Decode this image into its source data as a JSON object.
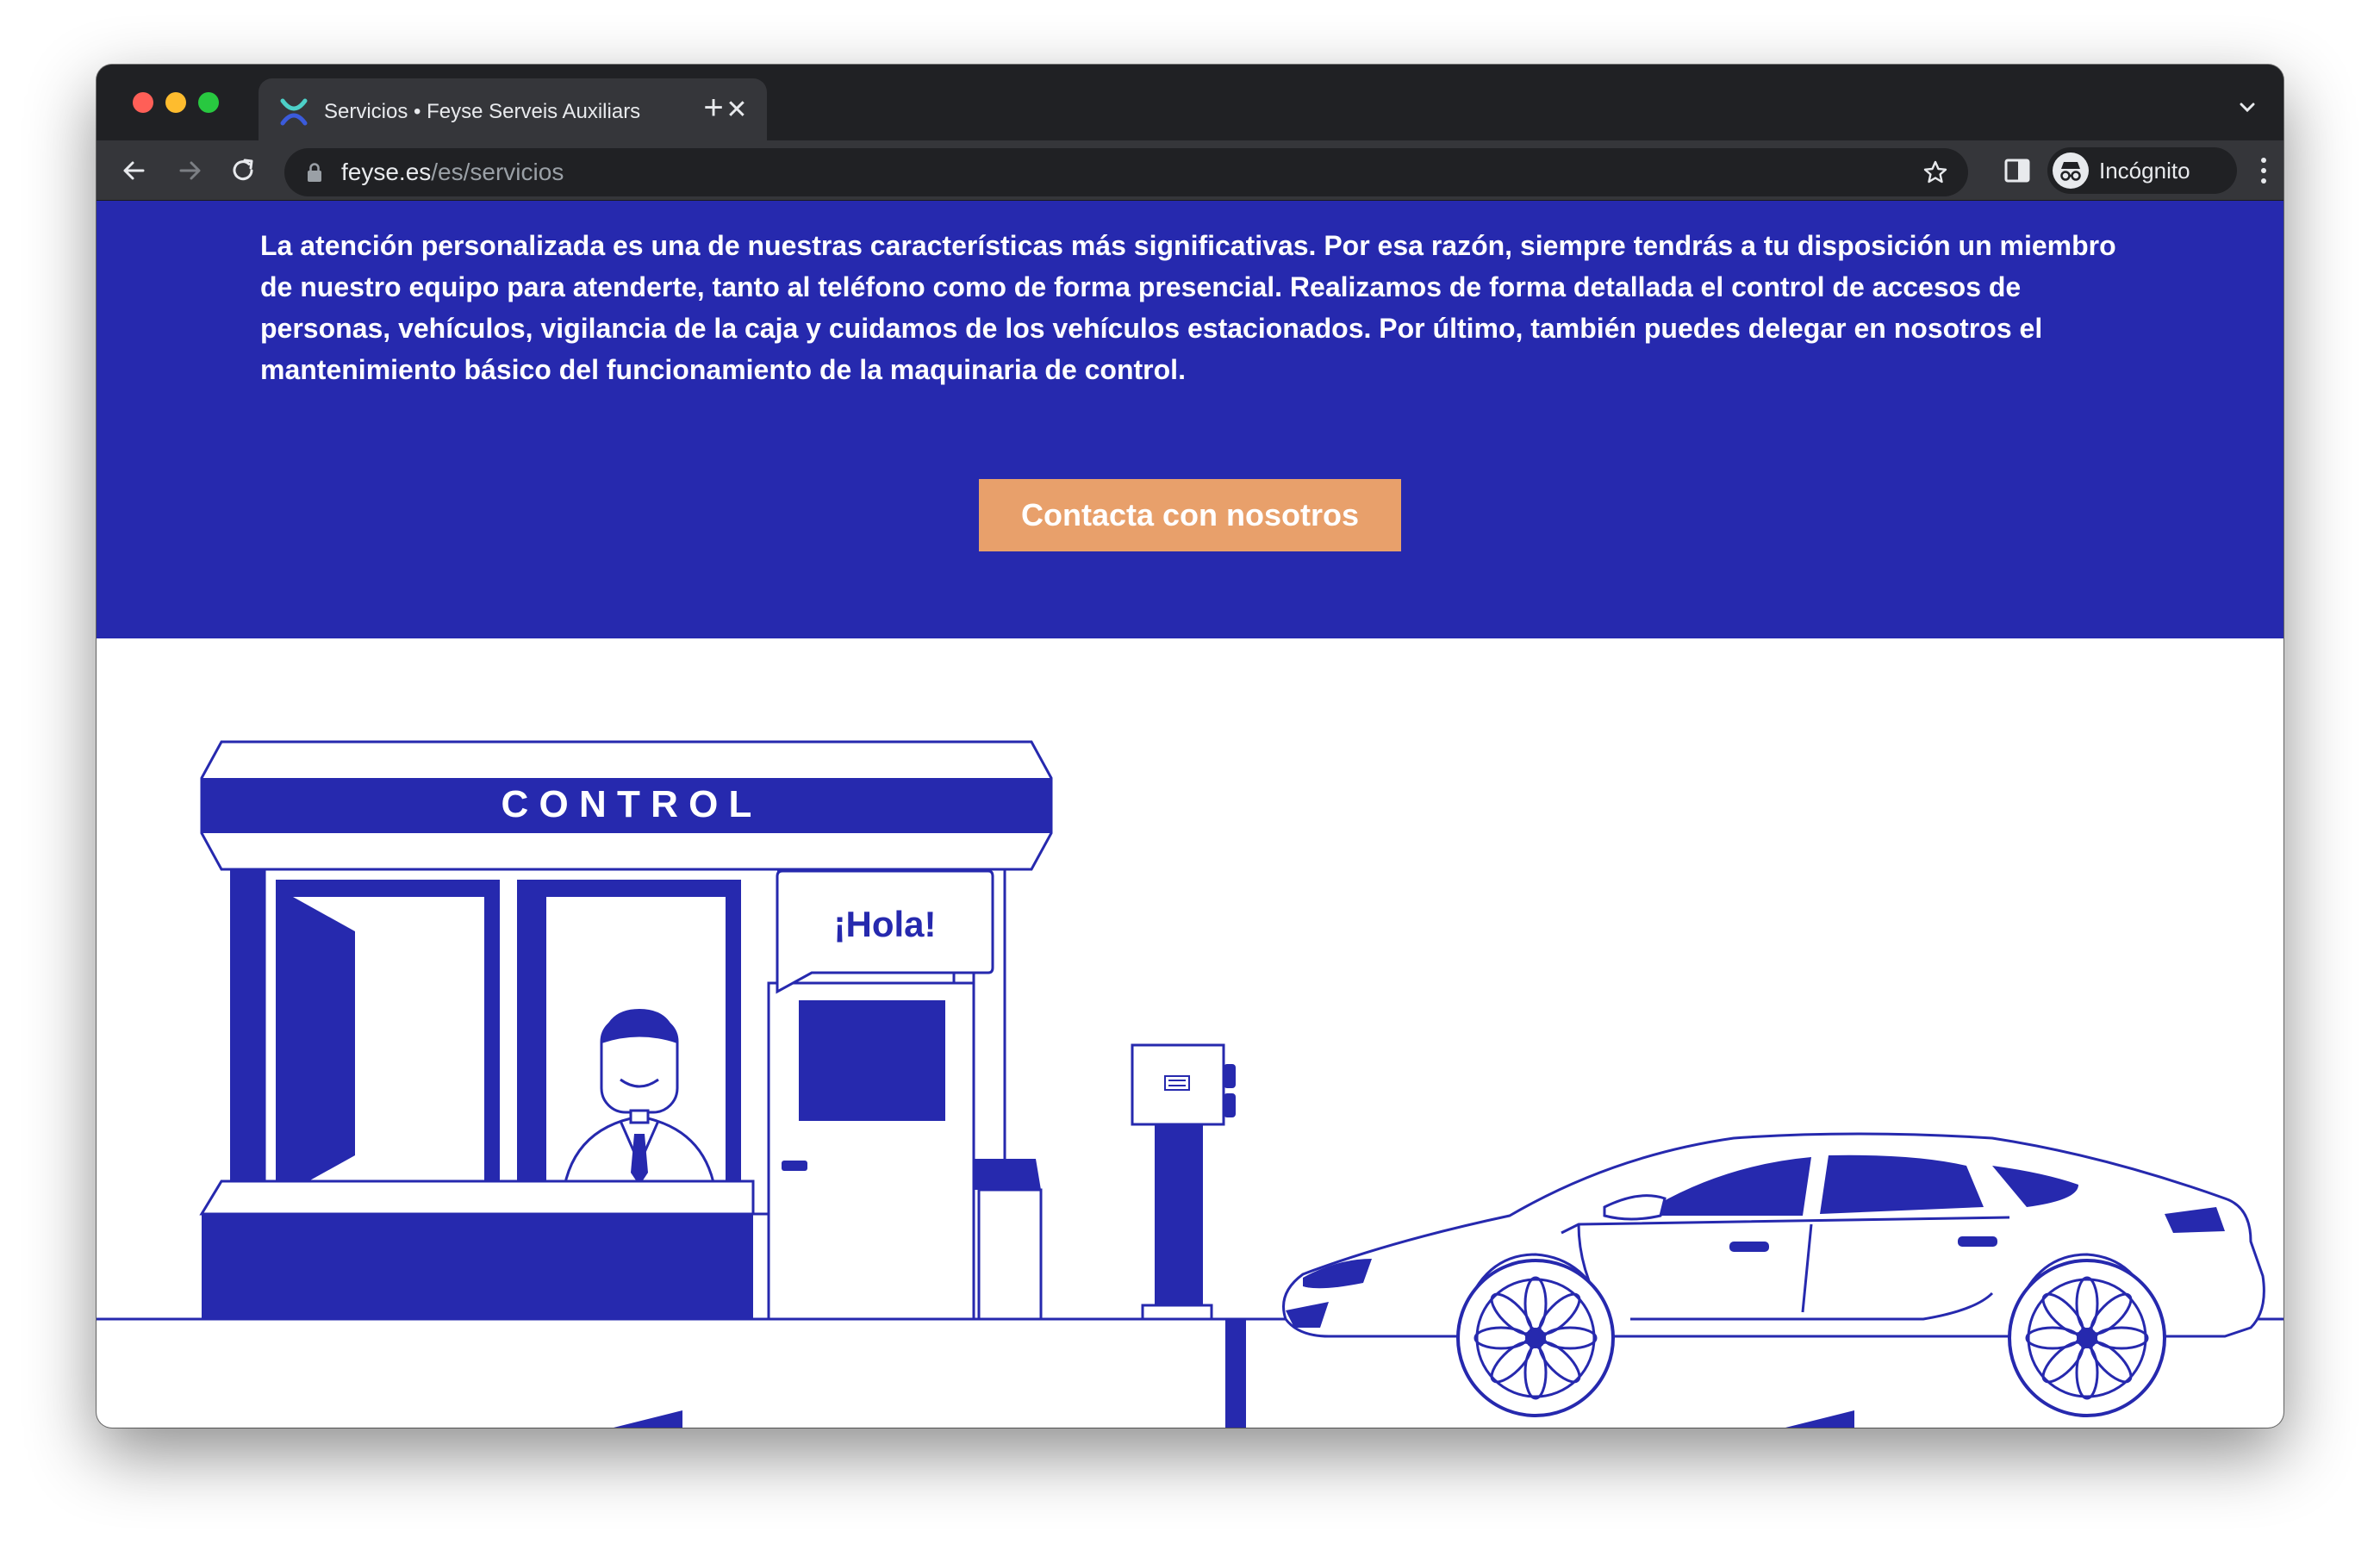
{
  "browser": {
    "tab": {
      "title": "Servicios • Feyse Serveis Auxiliars",
      "close": "✕"
    },
    "new_tab": "+",
    "url": {
      "domain": "feyse.es",
      "path": "/es/servicios"
    },
    "profile": {
      "label": "Incógnito"
    }
  },
  "hero": {
    "paragraph": "La atención personalizada es una de nuestras características más significativas. Por esa razón, siempre tendrás a tu disposición un miembro de nuestro equipo para atenderte, tanto al teléfono como de forma presencial. Realizamos de forma detallada el control de accesos de personas, vehículos, vigilancia de la caja y cuidamos de los vehículos estacionados. Por último, también puedes delegar en nosotros el mantenimiento básico del funcionamiento de la maquinaria de control.",
    "cta_label": "Contacta con nosotros"
  },
  "illustration": {
    "booth_sign": "C O N T R O L",
    "speech_bubble": "¡Hola!"
  },
  "colors": {
    "brand_blue": "#2629ae",
    "cta_orange": "#e8a06b",
    "chrome_dark": "#202124",
    "chrome_toolbar": "#35363a"
  }
}
